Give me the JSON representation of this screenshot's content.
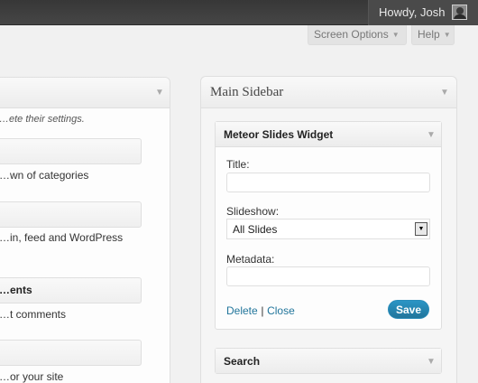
{
  "adminbar": {
    "greeting": "Howdy, Josh"
  },
  "screen_tabs": {
    "screen_options": "Screen Options",
    "help": "Help"
  },
  "left_panel": {
    "description": "…ete their settings.",
    "widgets": [
      {
        "title": "",
        "desc": "…wn of categories"
      },
      {
        "title": "",
        "desc": "…in, feed and WordPress"
      },
      {
        "title": "…ents",
        "desc": "…t comments"
      },
      {
        "title": "",
        "desc": "…or your site"
      }
    ]
  },
  "sidebar": {
    "title": "Main Sidebar",
    "meteor_widget": {
      "title": "Meteor Slides Widget",
      "title_label": "Title:",
      "title_value": "",
      "slideshow_label": "Slideshow:",
      "slideshow_value": "All Slides",
      "metadata_label": "Metadata:",
      "metadata_value": "",
      "delete_label": "Delete",
      "separator": "|",
      "close_label": "Close",
      "save_label": "Save"
    },
    "search_widget": {
      "title": "Search"
    }
  },
  "icons": {
    "toggle": "triangle-down-icon",
    "avatar": "user-avatar-icon"
  },
  "colors": {
    "link": "#21759b",
    "save_button": "#21759b",
    "adminbar": "#464646"
  }
}
